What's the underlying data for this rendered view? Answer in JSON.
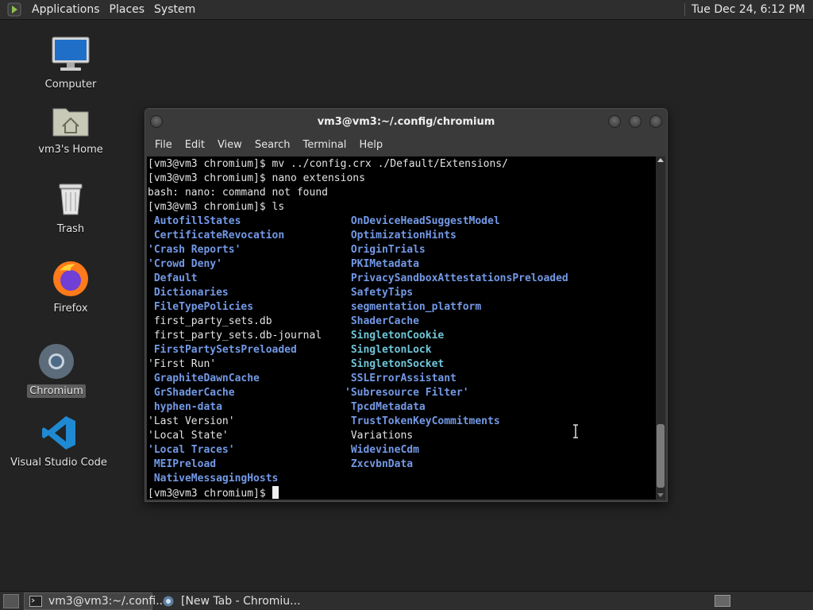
{
  "top_panel": {
    "menus": [
      "Applications",
      "Places",
      "System"
    ],
    "clock": "Tue Dec 24,  6:12 PM"
  },
  "desktop_icons": [
    {
      "label": "Computer",
      "icon": "computer-icon"
    },
    {
      "label": "vm3's Home",
      "icon": "home-folder-icon"
    },
    {
      "label": "Trash",
      "icon": "trash-icon"
    },
    {
      "label": "Firefox",
      "icon": "firefox-icon"
    },
    {
      "label": "Chromium",
      "icon": "chromium-icon",
      "selected": true
    },
    {
      "label": "Visual Studio Code",
      "icon": "vscode-icon"
    }
  ],
  "terminal": {
    "title": "vm3@vm3:~/.config/chromium",
    "menu": [
      "File",
      "Edit",
      "View",
      "Search",
      "Terminal",
      "Help"
    ],
    "lines": [
      "[vm3@vm3 chromium]$ mv ../config.crx ./Default/Extensions/",
      "[vm3@vm3 chromium]$ nano extensions",
      "bash: nano: command not found",
      "[vm3@vm3 chromium]$ ls"
    ],
    "ls_col1": [
      " AutofillStates",
      " CertificateRevocation",
      "'Crash Reports'",
      "'Crowd Deny'",
      " Default",
      " Dictionaries",
      " FileTypePolicies",
      " first_party_sets.db",
      " first_party_sets.db-journal",
      " FirstPartySetsPreloaded",
      "'First Run'",
      " GraphiteDawnCache",
      " GrShaderCache",
      " hyphen-data",
      "'Last Version'",
      "'Local State'",
      "'Local Traces'",
      " MEIPreload",
      " NativeMessagingHosts"
    ],
    "ls_col1_types": [
      "dir",
      "dir",
      "dir",
      "dir",
      "dir",
      "dir",
      "dir",
      "file",
      "file",
      "dir",
      "file",
      "dir",
      "dir",
      "dir",
      "file",
      "file",
      "dir",
      "dir",
      "dir"
    ],
    "ls_col2": [
      " OnDeviceHeadSuggestModel",
      " OptimizationHints",
      " OriginTrials",
      " PKIMetadata",
      " PrivacySandboxAttestationsPreloaded",
      " SafetyTips",
      " segmentation_platform",
      " ShaderCache",
      " SingletonCookie",
      " SingletonLock",
      " SingletonSocket",
      " SSLErrorAssistant",
      "'Subresource Filter'",
      " TpcdMetadata",
      " TrustTokenKeyCommitments",
      " Variations",
      " WidevineCdm",
      " ZxcvbnData"
    ],
    "ls_col2_types": [
      "dir",
      "dir",
      "dir",
      "dir",
      "dir",
      "dir",
      "dir",
      "dir",
      "sock",
      "sock",
      "sock",
      "dir",
      "dir",
      "dir",
      "dir",
      "file",
      "dir",
      "dir"
    ],
    "prompt": "[vm3@vm3 chromium]$ "
  },
  "taskbar": {
    "tasks": [
      {
        "label": "vm3@vm3:~/.confi...",
        "icon": "terminal-icon",
        "active": true
      },
      {
        "label": "[New Tab - Chromiu...",
        "icon": "chromium-icon",
        "active": false
      }
    ]
  },
  "colors": {
    "directory": "#7399e6",
    "socket": "#6fc6d8",
    "plain_file": "#e4e4e4"
  }
}
